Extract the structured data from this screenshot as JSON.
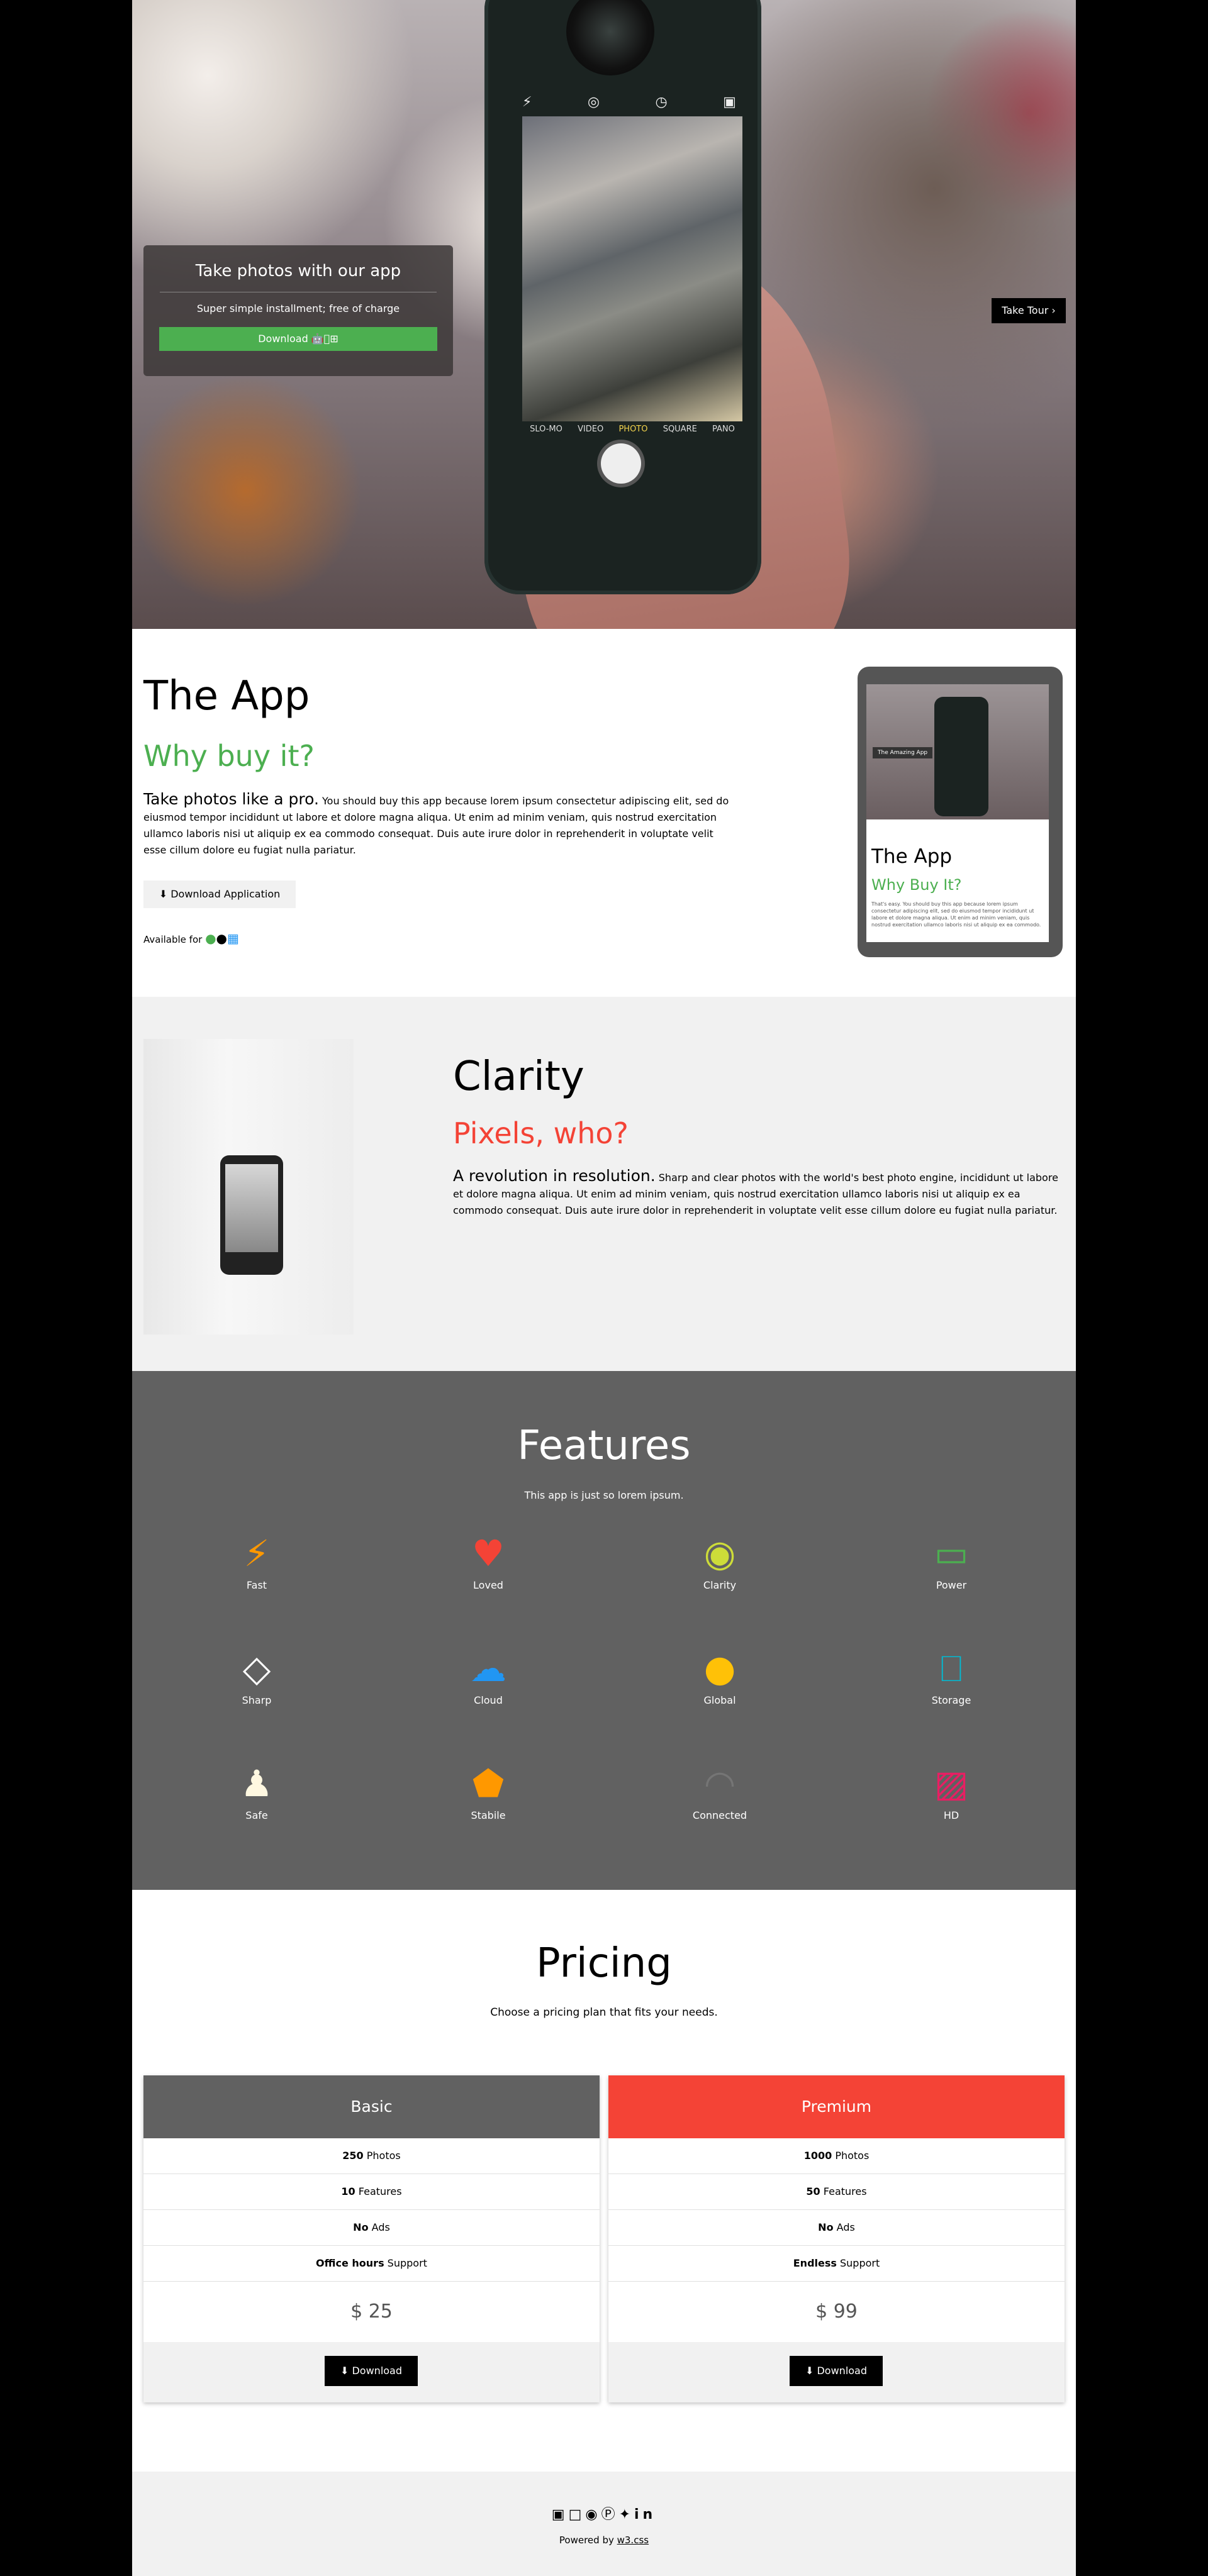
{
  "hero": {
    "card_title": "Take photos with our app",
    "card_subtitle": "Super simple installment; free of charge",
    "download_label": "Download",
    "download_icons": "🤖⊞",
    "tour_label": "Take Tour ›",
    "phone_modes": [
      "SLO-MO",
      "VIDEO",
      "PHOTO",
      "SQUARE",
      "PANO"
    ],
    "phone_icons": [
      "⚡",
      "◎",
      "◷",
      "▣"
    ]
  },
  "app": {
    "title": "The App",
    "subtitle": "Why buy it?",
    "lead": "Take photos like a pro.",
    "text": " You should buy this app because lorem ipsum consectetur adipiscing elit, sed do eiusmod tempor incididunt ut labore et dolore magna aliqua. Ut enim ad minim veniam, quis nostrud exercitation ullamco laboris nisi ut aliquip ex ea commodo consequat. Duis aute irure dolor in reprehenderit in voluptate velit esse cillum dolore eu fugiat nulla pariatur.",
    "button_label": "⬇ Download Application",
    "available_label": "Available for",
    "tablet": {
      "badge": "The Amazing App",
      "title": "The App",
      "subtitle": "Why Buy It?",
      "text": "That's easy. You should buy this app because lorem ipsum consectetur adipiscing elit, sed do eiusmod tempor incididunt ut labore et dolore magna aliqua. Ut enim ad minim veniam, quis nostrud exercitation ullamco laboris nisi ut aliquip ex ea commodo."
    }
  },
  "clarity": {
    "title": "Clarity",
    "subtitle": "Pixels, who?",
    "lead": "A revolution in resolution.",
    "text": " Sharp and clear photos with the world's best photo engine, incididunt ut labore et dolore magna aliqua. Ut enim ad minim veniam, quis nostrud exercitation ullamco laboris nisi ut aliquip ex ea commodo consequat. Duis aute irure dolor in reprehenderit in voluptate velit esse cillum dolore eu fugiat nulla pariatur."
  },
  "features": {
    "title": "Features",
    "subtitle": "This app is just so lorem ipsum.",
    "items": [
      {
        "label": "Fast",
        "glyph": "⚡",
        "color": "#ff9800"
      },
      {
        "label": "Loved",
        "glyph": "♥",
        "color": "#f44336"
      },
      {
        "label": "Clarity",
        "glyph": "◉",
        "color": "#cddc39"
      },
      {
        "label": "Power",
        "glyph": "▭",
        "color": "#4caf50"
      },
      {
        "label": "Sharp",
        "glyph": "◇",
        "color": "#ffffff"
      },
      {
        "label": "Cloud",
        "glyph": "☁",
        "color": "#2196f3"
      },
      {
        "label": "Global",
        "glyph": "●",
        "color": "#ffc107"
      },
      {
        "label": "Storage",
        "glyph": "⎕",
        "color": "#00bcd4"
      },
      {
        "label": "Safe",
        "glyph": "♟",
        "color": "#fff8e1"
      },
      {
        "label": "Stabile",
        "glyph": "⬟",
        "color": "#ff9800"
      },
      {
        "label": "Connected",
        "glyph": "◠",
        "color": "#757575"
      },
      {
        "label": "HD",
        "glyph": "▨",
        "color": "#e91e63"
      }
    ]
  },
  "pricing": {
    "title": "Pricing",
    "subtitle": "Choose a pricing plan that fits your needs.",
    "plans": [
      {
        "name": "Basic",
        "color": "#616161",
        "rows": [
          [
            "250",
            " Photos"
          ],
          [
            "10",
            " Features"
          ],
          [
            "No",
            " Ads"
          ],
          [
            "Office hours",
            " Support"
          ]
        ],
        "price": "$ 25",
        "button": "⬇ Download"
      },
      {
        "name": "Premium",
        "color": "#f44336",
        "rows": [
          [
            "1000",
            " Photos"
          ],
          [
            "50",
            " Features"
          ],
          [
            "No",
            " Ads"
          ],
          [
            "Endless",
            " Support"
          ]
        ],
        "price": "$ 99",
        "button": "⬇ Download"
      }
    ]
  },
  "footer": {
    "social_icons": [
      "facebook-icon",
      "instagram-icon",
      "snapchat-icon",
      "pinterest-icon",
      "twitter-icon",
      "linkedin-icon"
    ],
    "powered_prefix": "Powered by ",
    "powered_link": "w3.css"
  }
}
